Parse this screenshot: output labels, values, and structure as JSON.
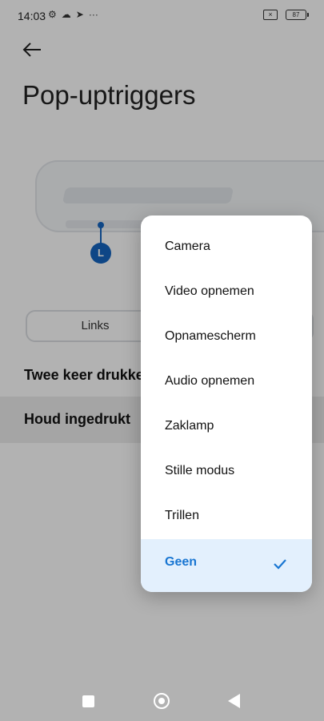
{
  "status_bar": {
    "time": "14:03",
    "battery_level": "87",
    "left_icons": [
      "gear-icon",
      "cloud-icon",
      "play-icon",
      "more-icon"
    ]
  },
  "header": {
    "title": "Pop-uptriggers"
  },
  "illustration": {
    "marker_label": "L"
  },
  "segment": {
    "left_label": "Links"
  },
  "settings": {
    "row1_label": "Twee keer drukke",
    "row2_label": "Houd ingedrukt"
  },
  "menu": {
    "items": [
      {
        "label": "Camera"
      },
      {
        "label": "Video opnemen"
      },
      {
        "label": "Opnamescherm"
      },
      {
        "label": "Audio opnemen"
      },
      {
        "label": "Zaklamp"
      },
      {
        "label": "Stille modus"
      },
      {
        "label": "Trillen"
      },
      {
        "label": "Geen",
        "selected": true
      }
    ],
    "accent_color": "#1976d2",
    "selected_bg": "#e3f0fd"
  }
}
